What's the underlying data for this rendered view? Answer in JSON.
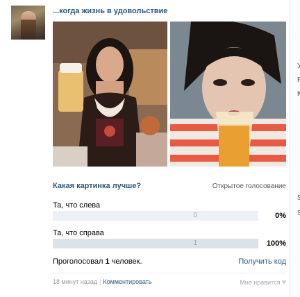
{
  "post": {
    "title": "...когда жизнь в удовольствие"
  },
  "poll": {
    "question": "Какая картинка лучше?",
    "type": "Открытое голосование",
    "options": [
      {
        "label": "Та, что слева",
        "count": "0",
        "percent": "0%",
        "fraction": 0
      },
      {
        "label": "Та, что справа",
        "count": "1",
        "percent": "100%",
        "fraction": 1
      }
    ],
    "voted_prefix": "Проголосовал ",
    "voted_count": "1",
    "voted_suffix": " человек.",
    "get_code": "Получить код"
  },
  "footer": {
    "time": "18 минут назад",
    "comment": "Комментировать",
    "like": "Мне нравится"
  },
  "sidebar_letters": [
    "У",
    "Р",
    "К",
    "S",
    "S"
  ],
  "colors": {
    "link": "#2b587a",
    "bar_bg": "#edf1f5",
    "bar_fill": "#dae2ea"
  }
}
